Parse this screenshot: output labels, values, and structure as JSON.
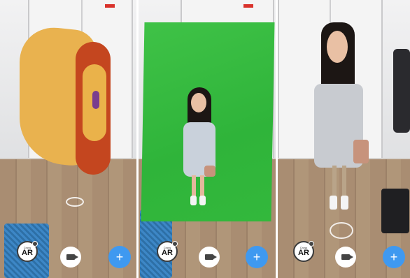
{
  "panels": [
    {
      "id": "panel-lion",
      "subject": "lion",
      "toolbar": {
        "ar_small_label": "Cross",
        "ar_label": "AR",
        "add_label": "+"
      }
    },
    {
      "id": "panel-greenscreen",
      "subject": "person-green-screen",
      "toolbar": {
        "ar_small_label": "Cross",
        "ar_label": "AR",
        "add_label": "+"
      }
    },
    {
      "id": "panel-cutout",
      "subject": "person-cutout",
      "toolbar": {
        "ar_small_label": "Cross",
        "ar_label": "AR",
        "add_label": "+"
      }
    }
  ],
  "colors": {
    "add_button": "#3f99f0",
    "green_screen": "#33b83c",
    "lion_body": "#e9b24f",
    "lion_mane": "#c4461f"
  },
  "icons": {
    "ar": "ar-logo-icon",
    "record": "video-camera-icon",
    "add": "plus-icon"
  }
}
